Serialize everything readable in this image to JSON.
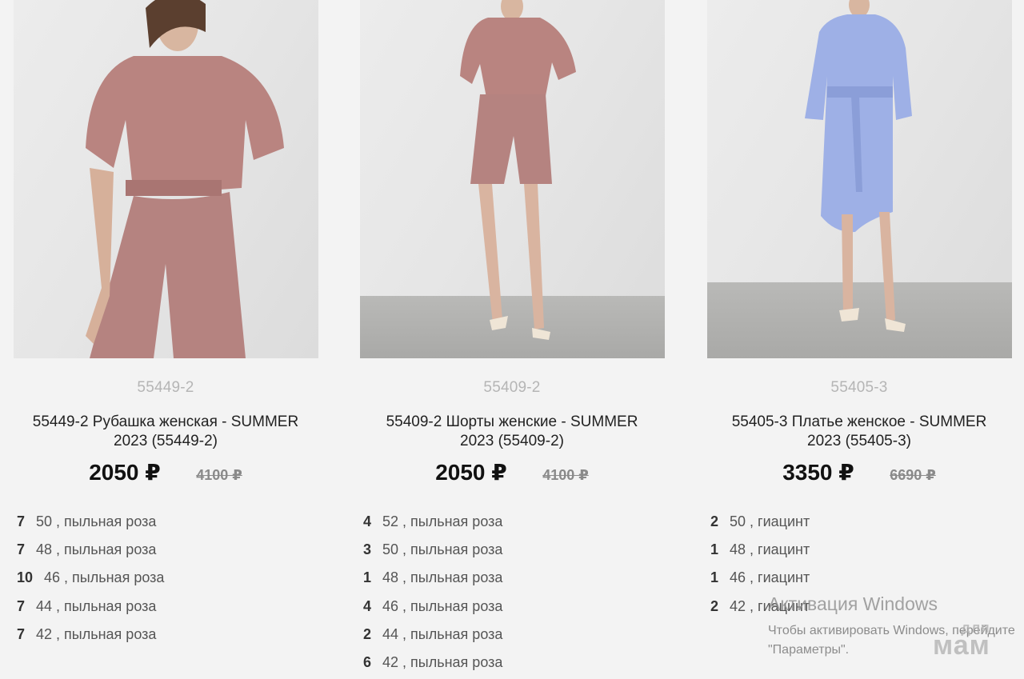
{
  "products": [
    {
      "sku": "55449-2",
      "title": "55449-2 Рубашка женская - SUMMER 2023 (55449-2)",
      "price": "2050 ₽",
      "old_price": "4100 ₽",
      "photo_alt": "Розовая рубашка и шорты",
      "stock": [
        {
          "qty": "7",
          "size": "50 , пыльная роза"
        },
        {
          "qty": "7",
          "size": "48 , пыльная роза"
        },
        {
          "qty": "10",
          "size": "46 , пыльная роза"
        },
        {
          "qty": "7",
          "size": "44 , пыльная роза"
        },
        {
          "qty": "7",
          "size": "42 , пыльная роза"
        }
      ]
    },
    {
      "sku": "55409-2",
      "title": "55409-2 Шорты женские - SUMMER 2023 (55409-2)",
      "price": "2050 ₽",
      "old_price": "4100 ₽",
      "photo_alt": "Розовые шорты и рубашка",
      "stock": [
        {
          "qty": "4",
          "size": "52 , пыльная роза"
        },
        {
          "qty": "3",
          "size": "50 , пыльная роза"
        },
        {
          "qty": "1",
          "size": "48 , пыльная роза"
        },
        {
          "qty": "4",
          "size": "46 , пыльная роза"
        },
        {
          "qty": "2",
          "size": "44 , пыльная роза"
        },
        {
          "qty": "6",
          "size": "42 , пыльная роза"
        }
      ]
    },
    {
      "sku": "55405-3",
      "title": "55405-3 Платье женское - SUMMER 2023 (55405-3)",
      "price": "3350 ₽",
      "old_price": "6690 ₽",
      "photo_alt": "Голубое платье-рубашка",
      "stock": [
        {
          "qty": "2",
          "size": "50 , гиацинт"
        },
        {
          "qty": "1",
          "size": "48 , гиацинт"
        },
        {
          "qty": "1",
          "size": "46 , гиацинт"
        },
        {
          "qty": "2",
          "size": "42 , гиацинт"
        }
      ]
    }
  ],
  "watermark": {
    "title": "Активация Windows",
    "line1": "Чтобы активировать Windows, перейдите",
    "line2": "\"Параметры\"."
  },
  "logo": {
    "top": "для",
    "bottom": "мам"
  },
  "colors": {
    "pink": "#b98480",
    "blue": "#9eb0e6",
    "background": "#f3f3f3"
  }
}
